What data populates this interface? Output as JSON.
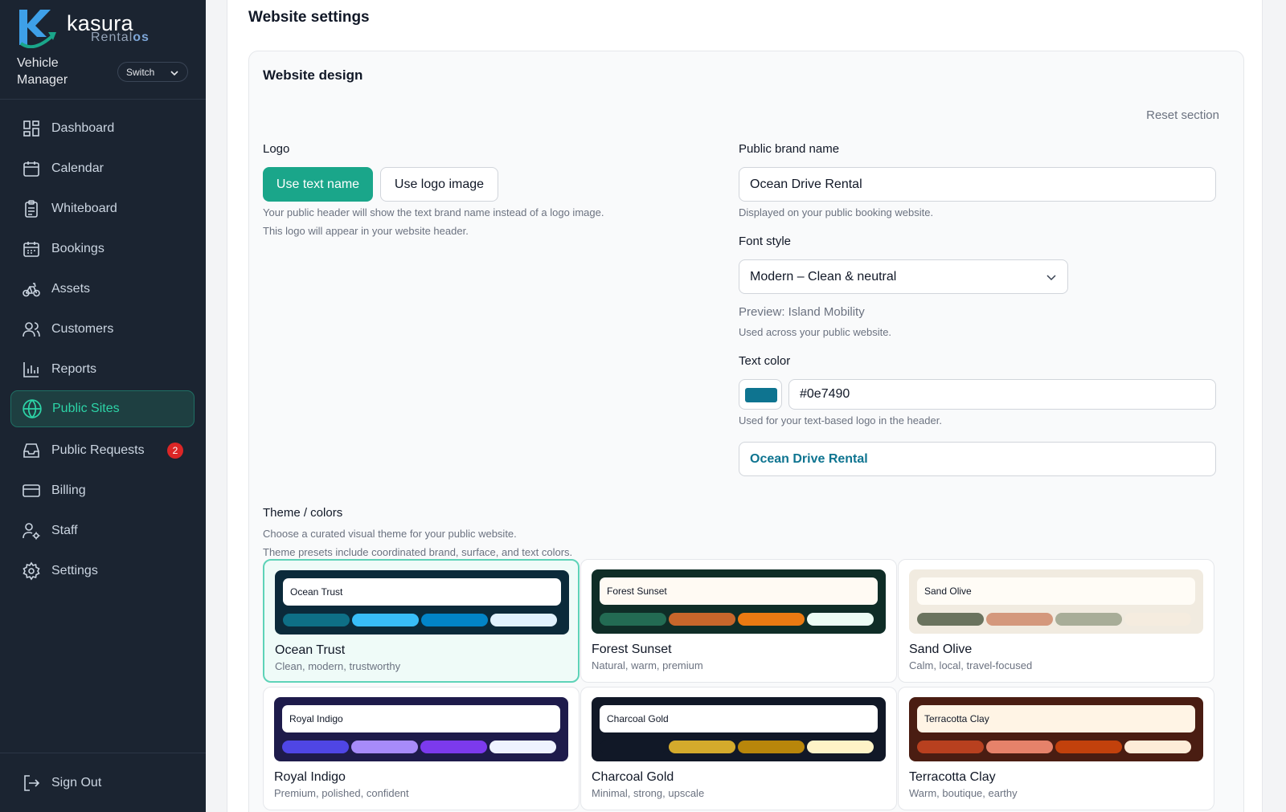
{
  "brand": {
    "name": "kasura",
    "sub_main": "Rental",
    "sub_accent": "os"
  },
  "context": {
    "label": "Vehicle Manager",
    "switch_label": "Switch"
  },
  "nav": [
    {
      "label": "Dashboard",
      "icon": "dashboard-icon"
    },
    {
      "label": "Calendar",
      "icon": "calendar-icon"
    },
    {
      "label": "Whiteboard",
      "icon": "clipboard-icon"
    },
    {
      "label": "Bookings",
      "icon": "calendar-grid-icon"
    },
    {
      "label": "Assets",
      "icon": "bicycle-icon"
    },
    {
      "label": "Customers",
      "icon": "users-icon"
    },
    {
      "label": "Reports",
      "icon": "bar-chart-icon"
    },
    {
      "label": "Public Sites",
      "icon": "globe-icon",
      "active": true
    },
    {
      "label": "Public Requests",
      "icon": "inbox-icon",
      "badge": "2"
    },
    {
      "label": "Billing",
      "icon": "credit-card-icon"
    },
    {
      "label": "Staff",
      "icon": "user-gear-icon"
    },
    {
      "label": "Settings",
      "icon": "gear-icon"
    }
  ],
  "sign_out": {
    "label": "Sign Out",
    "icon": "sign-out-icon"
  },
  "page": {
    "title": "Website settings"
  },
  "design": {
    "title": "Website design",
    "reset_label": "Reset section",
    "logo": {
      "label": "Logo",
      "use_text_label": "Use text name",
      "use_image_label": "Use logo image",
      "hint1": "Your public header will show the text brand name instead of a logo image.",
      "hint2": "This logo will appear in your website header."
    },
    "brand_name": {
      "label": "Public brand name",
      "value": "Ocean Drive Rental",
      "hint": "Displayed on your public booking website."
    },
    "font": {
      "label": "Font style",
      "value": "Modern – Clean & neutral",
      "preview": "Preview: Island Mobility",
      "hint": "Used across your public website."
    },
    "text_color": {
      "label": "Text color",
      "value": "#0e7490",
      "hint": "Used for your text-based logo in the header.",
      "preview": "Ocean Drive Rental"
    },
    "theme": {
      "label": "Theme / colors",
      "hint1": "Choose a curated visual theme for your public website.",
      "hint2": "Theme presets include coordinated brand, surface, and text colors.",
      "presets": [
        {
          "name": "Ocean Trust",
          "desc": "Clean, modern, trustworthy",
          "selected": true,
          "frame": "#0b2a3a",
          "bar": "#ffffff",
          "pills": [
            "#0e6f86",
            "#38bdf8",
            "#0284c7",
            "#e0f2fe"
          ]
        },
        {
          "name": "Forest Sunset",
          "desc": "Natural, warm, premium",
          "frame": "#0f2d27",
          "bar": "#fffaf3",
          "pills": [
            "#236b53",
            "#c7662b",
            "#ea7a12",
            "#ecfdf5"
          ]
        },
        {
          "name": "Sand Olive",
          "desc": "Calm, local, travel-focused",
          "frame": "#f1ebe0",
          "bar": "#fffcf6",
          "pills": [
            "#6a735e",
            "#d4987c",
            "#a8ad98",
            "#f5ecdf"
          ]
        },
        {
          "name": "Royal Indigo",
          "desc": "Premium, polished, confident",
          "frame": "#1e1b4b",
          "bar": "#ffffff",
          "pills": [
            "#4f46e5",
            "#a78bfa",
            "#7c3aed",
            "#eef2ff"
          ]
        },
        {
          "name": "Charcoal Gold",
          "desc": "Minimal, strong, upscale",
          "frame": "#111827",
          "bar": "#ffffff",
          "pills": [
            "#111827",
            "#d4aa2c",
            "#b8860b",
            "#fef3c7"
          ]
        },
        {
          "name": "Terracotta Clay",
          "desc": "Warm, boutique, earthy",
          "frame": "#4a1d12",
          "bar": "#fff4e5",
          "pills": [
            "#b8401f",
            "#e6826a",
            "#c2410c",
            "#fdecd8"
          ]
        }
      ]
    }
  }
}
